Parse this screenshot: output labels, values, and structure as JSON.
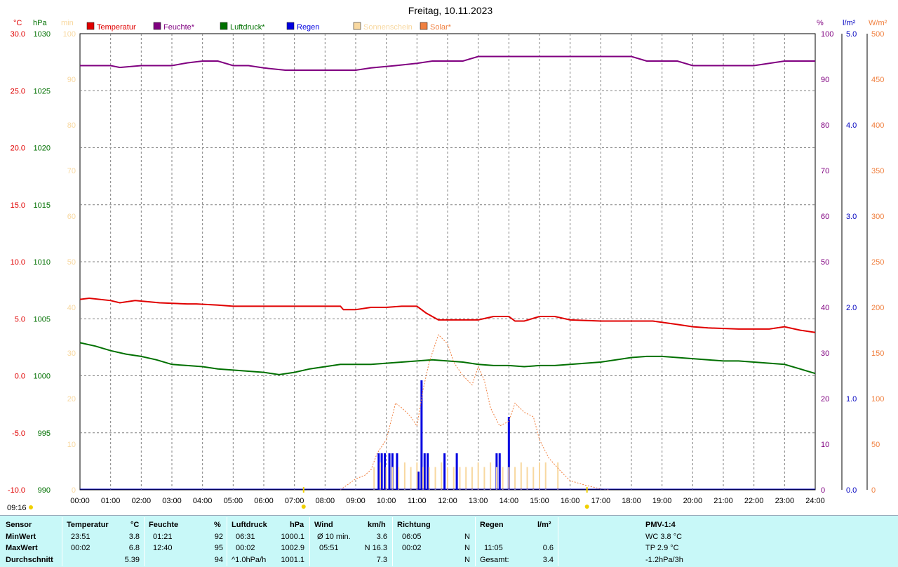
{
  "title": "Freitag, 10.11.2023",
  "time_stamp": "09:16",
  "legend": [
    {
      "label": "Temperatur",
      "color": "#e00000"
    },
    {
      "label": "Feuchte*",
      "color": "#800080"
    },
    {
      "label": "Luftdruck*",
      "color": "#007000"
    },
    {
      "label": "Regen",
      "color": "#0000e0"
    },
    {
      "label": "Sonnenschein",
      "color": "#f8d8a0"
    },
    {
      "label": "Solar*",
      "color": "#f08040"
    }
  ],
  "axis_units": {
    "temp": "°C",
    "press": "hPa",
    "sun": "min",
    "hum": "%",
    "rain": "l/m²",
    "solar": "W/m²"
  },
  "chart_data": {
    "type": "line",
    "title": "Freitag, 10.11.2023",
    "x_ticks": [
      "00:00",
      "01:00",
      "02:00",
      "03:00",
      "04:00",
      "05:00",
      "06:00",
      "07:00",
      "08:00",
      "09:00",
      "10:00",
      "11:00",
      "12:00",
      "13:00",
      "14:00",
      "15:00",
      "16:00",
      "17:00",
      "18:00",
      "19:00",
      "20:00",
      "21:00",
      "22:00",
      "23:00",
      "24:00"
    ],
    "xlim": [
      0,
      24
    ],
    "axes": {
      "temp": {
        "range": [
          -10,
          30
        ],
        "ticks": [
          "30.0",
          "25.0",
          "20.0",
          "15.0",
          "10.0",
          "5.0",
          "0.0",
          "-5.0",
          "-10.0"
        ]
      },
      "press": {
        "range": [
          990,
          1030
        ],
        "ticks": [
          "1030",
          "1025",
          "1020",
          "1015",
          "1010",
          "1005",
          "1000",
          "995",
          "990"
        ]
      },
      "sun": {
        "range": [
          0,
          100
        ],
        "ticks": [
          "100",
          "90",
          "80",
          "70",
          "60",
          "50",
          "40",
          "30",
          "20",
          "10",
          "0"
        ]
      },
      "hum": {
        "range": [
          0,
          100
        ],
        "ticks": [
          "100",
          "90",
          "80",
          "70",
          "60",
          "50",
          "40",
          "30",
          "20",
          "10",
          "0"
        ]
      },
      "rain": {
        "range": [
          0,
          5
        ],
        "ticks": [
          "5.0",
          "4.0",
          "3.0",
          "2.0",
          "1.0",
          "0.0"
        ]
      },
      "solar": {
        "range": [
          0,
          500
        ],
        "ticks": [
          "500",
          "450",
          "400",
          "350",
          "300",
          "250",
          "200",
          "150",
          "100",
          "50",
          "0"
        ]
      }
    },
    "series": [
      {
        "name": "Temperatur",
        "axis": "temp",
        "color": "#e00000",
        "x": [
          0,
          0.3,
          1.0,
          1.3,
          1.8,
          2.2,
          2.6,
          3.5,
          3.8,
          4.5,
          5.0,
          6.0,
          7.0,
          8.0,
          8.5,
          8.6,
          9.0,
          9.5,
          10.0,
          10.5,
          11.0,
          11.3,
          11.7,
          12.5,
          13.0,
          13.5,
          14.0,
          14.2,
          14.5,
          15.0,
          15.5,
          16.0,
          17.0,
          18.0,
          18.7,
          19.5,
          20.0,
          20.5,
          21.5,
          22.5,
          23.0,
          23.5,
          24.0
        ],
        "y": [
          6.7,
          6.8,
          6.6,
          6.4,
          6.6,
          6.5,
          6.4,
          6.3,
          6.3,
          6.2,
          6.1,
          6.1,
          6.1,
          6.1,
          6.1,
          5.8,
          5.8,
          6.0,
          6.0,
          6.1,
          6.1,
          5.5,
          4.9,
          4.9,
          4.9,
          5.2,
          5.2,
          4.8,
          4.8,
          5.2,
          5.2,
          4.9,
          4.8,
          4.8,
          4.8,
          4.5,
          4.3,
          4.2,
          4.1,
          4.1,
          4.3,
          4.0,
          3.8
        ]
      },
      {
        "name": "Feuchte*",
        "axis": "hum",
        "color": "#800080",
        "x": [
          0,
          1.0,
          1.3,
          2.0,
          3.0,
          3.5,
          4.0,
          4.5,
          5.0,
          5.5,
          6.0,
          6.7,
          8.0,
          9.0,
          9.5,
          10.3,
          11.0,
          11.5,
          12.5,
          13.0,
          14.0,
          15.0,
          16.0,
          17.0,
          18.0,
          18.5,
          19.5,
          20.0,
          21.0,
          22.0,
          23.0,
          24.0
        ],
        "y": [
          93,
          93,
          92.6,
          93,
          93,
          93.6,
          94,
          94,
          93,
          93,
          92.5,
          92,
          92,
          92,
          92.5,
          93,
          93.5,
          94,
          94,
          95,
          95,
          95,
          95,
          95,
          95,
          94,
          94,
          93,
          93,
          93,
          94,
          94
        ]
      },
      {
        "name": "Luftdruck*",
        "axis": "press",
        "color": "#007000",
        "x": [
          0,
          0.5,
          1.0,
          1.5,
          2.0,
          2.5,
          3.0,
          3.5,
          4.0,
          4.5,
          5.0,
          5.5,
          6.0,
          6.5,
          7.0,
          7.5,
          8.0,
          8.5,
          9.0,
          9.5,
          10.0,
          10.5,
          11.0,
          11.5,
          12.0,
          12.5,
          13.0,
          13.5,
          14.0,
          14.5,
          15.0,
          15.5,
          16.0,
          16.5,
          17.0,
          17.5,
          18.0,
          18.5,
          19.0,
          19.5,
          20.0,
          20.5,
          21.0,
          21.5,
          22.0,
          22.5,
          23.0,
          23.5,
          24.0
        ],
        "y": [
          1002.9,
          1002.6,
          1002.2,
          1001.9,
          1001.7,
          1001.4,
          1001.0,
          1000.9,
          1000.8,
          1000.6,
          1000.5,
          1000.4,
          1000.3,
          1000.1,
          1000.3,
          1000.6,
          1000.8,
          1001.0,
          1001.0,
          1001.0,
          1001.1,
          1001.2,
          1001.3,
          1001.4,
          1001.3,
          1001.2,
          1001.0,
          1000.9,
          1000.9,
          1000.8,
          1000.9,
          1000.9,
          1001.0,
          1001.1,
          1001.2,
          1001.4,
          1001.6,
          1001.7,
          1001.7,
          1001.6,
          1001.5,
          1001.4,
          1001.3,
          1001.3,
          1001.2,
          1001.1,
          1001.0,
          1000.6,
          1000.2
        ]
      },
      {
        "name": "Solar*",
        "axis": "solar",
        "color": "#f08040",
        "x": [
          8.5,
          9.0,
          9.3,
          9.5,
          9.7,
          10.0,
          10.3,
          10.5,
          10.8,
          11.0,
          11.2,
          11.4,
          11.7,
          12.0,
          12.2,
          12.5,
          12.8,
          13.0,
          13.2,
          13.4,
          13.7,
          14.0,
          14.2,
          14.5,
          14.8,
          15.0,
          15.3,
          15.7,
          16.0,
          16.5,
          17.0,
          17.3
        ],
        "y": [
          0,
          12,
          16,
          22,
          40,
          55,
          95,
          90,
          80,
          70,
          110,
          140,
          170,
          160,
          140,
          125,
          115,
          135,
          120,
          90,
          70,
          75,
          95,
          85,
          80,
          55,
          35,
          20,
          10,
          5,
          1,
          0
        ]
      },
      {
        "name": "Regen",
        "axis": "rain",
        "color": "#0000e0",
        "type": "bar",
        "x": [
          9.75,
          9.85,
          9.95,
          10.1,
          10.2,
          10.35,
          11.05,
          11.15,
          11.25,
          11.35,
          11.9,
          12.3,
          13.6,
          13.7,
          14.0
        ],
        "y": [
          0.4,
          0.4,
          0.4,
          0.4,
          0.4,
          0.4,
          0.2,
          1.2,
          0.4,
          0.4,
          0.4,
          0.4,
          0.4,
          0.4,
          0.8
        ]
      },
      {
        "name": "Sonnenschein",
        "axis": "sun",
        "color": "#f8d8a0",
        "type": "bar",
        "x": [
          9.6,
          9.8,
          10.0,
          10.2,
          10.4,
          10.6,
          10.8,
          11.0,
          11.2,
          11.4,
          11.6,
          11.8,
          12.0,
          12.2,
          12.4,
          12.6,
          12.8,
          13.0,
          13.2,
          13.4,
          13.6,
          13.8,
          14.0,
          14.2,
          14.4,
          14.6,
          14.8,
          15.0,
          15.2,
          15.6
        ],
        "y": [
          5,
          6,
          5,
          5,
          5,
          6,
          5,
          6,
          5,
          5,
          5,
          6,
          5,
          5,
          5,
          5,
          5,
          6,
          5,
          6,
          5,
          5,
          5,
          5,
          6,
          5,
          5,
          6,
          6,
          6
        ]
      }
    ]
  },
  "stats": {
    "headers": {
      "sensor": "Sensor",
      "temp": "Temperatur",
      "temp_u": "°C",
      "hum": "Feuchte",
      "hum_u": "%",
      "press": "Luftdruck",
      "press_u": "hPa",
      "wind": "Wind",
      "wind_u": "km/h",
      "dir": "Richtung",
      "rain": "Regen",
      "rain_u": "l/m²",
      "pmv": "PMV-1:4"
    },
    "rows": [
      {
        "label": "MinWert",
        "t_time": "23:51",
        "t_val": "3.8",
        "h_time": "01:21",
        "h_val": "92",
        "p_time": "06:31",
        "p_val": "1000.1",
        "w_label": "Ø 10 min.",
        "w_val": "3.6",
        "d_time": "06:05",
        "d_val": "N",
        "r_label": "",
        "r_val": "",
        "pmv": "WC 3.8 °C"
      },
      {
        "label": "MaxWert",
        "t_time": "00:02",
        "t_val": "6.8",
        "h_time": "12:40",
        "h_val": "95",
        "p_time": "00:02",
        "p_val": "1002.9",
        "w_label": "05:51",
        "w_val": "N 16.3",
        "d_time": "00:02",
        "d_val": "N",
        "r_label": "11:05",
        "r_val": "0.6",
        "pmv": "TP 2.9 °C"
      },
      {
        "label": "Durchschnitt",
        "t_time": "",
        "t_val": "5.39",
        "h_time": "",
        "h_val": "94",
        "p_time": "^1.0hPa/h",
        "p_val": "1001.1",
        "w_label": "",
        "w_val": "7.3",
        "d_time": "",
        "d_val": "N",
        "r_label": "Gesamt:",
        "r_val": "3.4",
        "pmv": "-1.2hPa/3h"
      }
    ]
  }
}
